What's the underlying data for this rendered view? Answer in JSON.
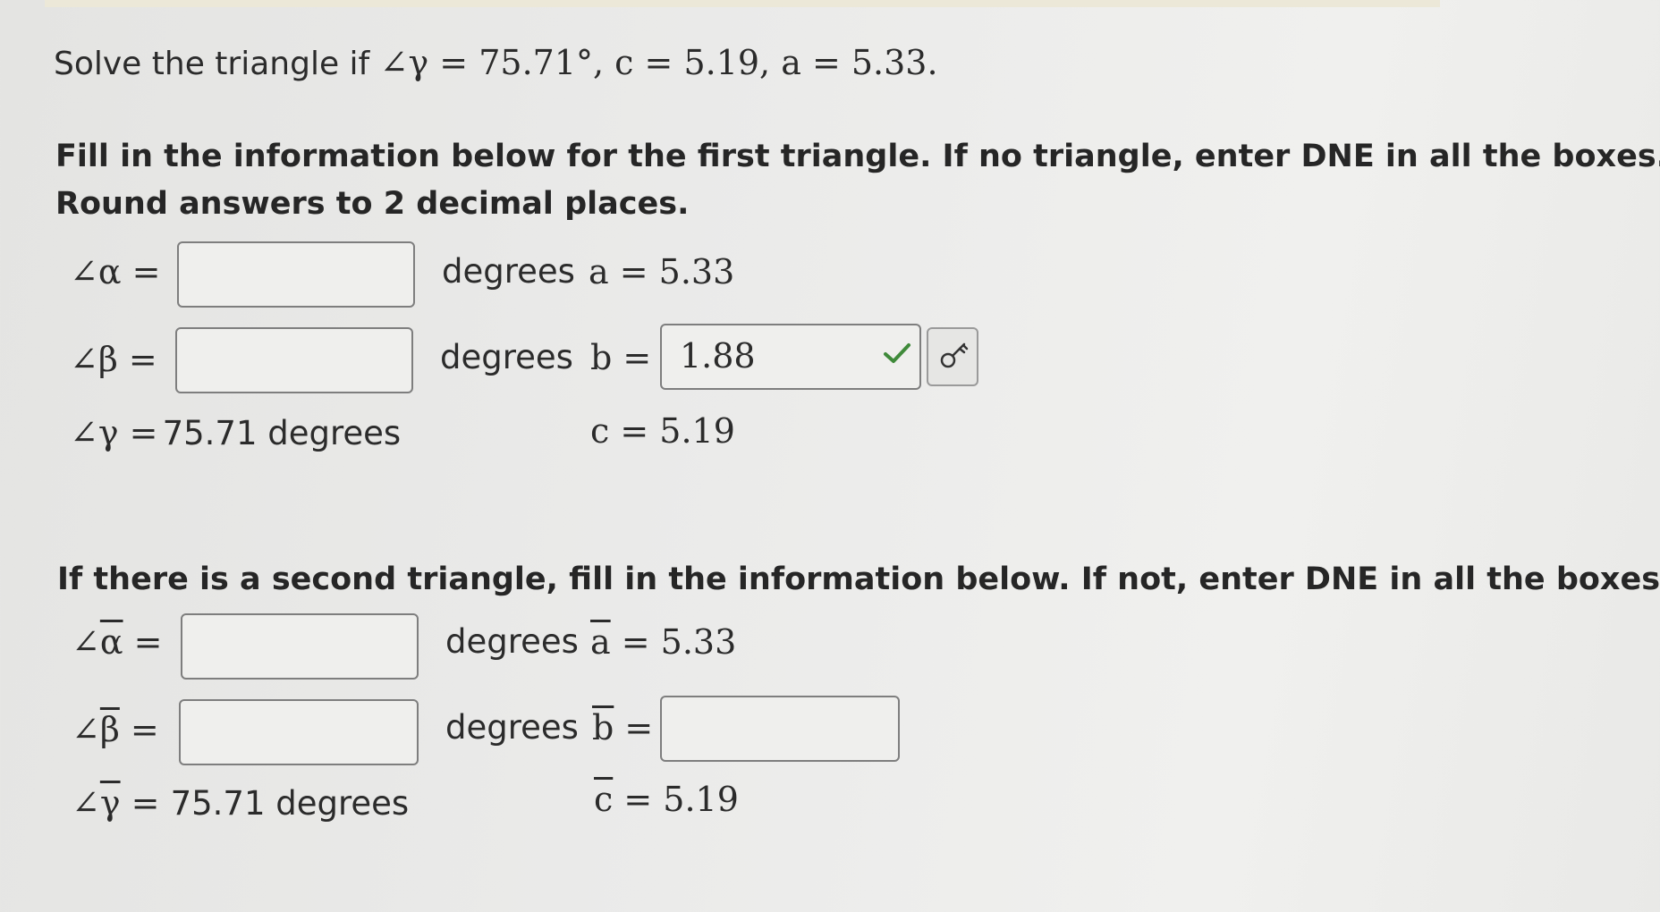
{
  "problem": {
    "prefix": "Solve the triangle if",
    "math": "∠γ = 75.71°, c = 5.19, a = 5.33."
  },
  "first": {
    "instruction_line1": "Fill in the information below for the first triangle. If no triangle, enter DNE in all the boxes.",
    "instruction_line2": "Round answers to 2 decimal places.",
    "alpha_label": "∠α =",
    "beta_label": "∠β =",
    "gamma_label": "∠γ =",
    "gamma_value": "75.71 degrees",
    "alpha_unit": "degrees",
    "beta_unit": "degrees",
    "alpha_input": "",
    "beta_input": "",
    "a_label": "a = 5.33",
    "b_label": "b =",
    "b_input": "1.88",
    "c_label": "c = 5.19"
  },
  "second": {
    "instruction": "If there is a second triangle, fill in the information below. If not, enter DNE in all the boxes.",
    "alpha_label_pre": "∠",
    "alpha_sym": "α",
    "alpha_label_post": " =",
    "beta_label_pre": "∠",
    "beta_sym": "β",
    "beta_label_post": " =",
    "gamma_label_pre": "∠",
    "gamma_sym": "γ",
    "gamma_label_post": " = ",
    "gamma_value": "75.71 degrees",
    "alpha_unit": "degrees",
    "beta_unit": "degrees",
    "alpha_input": "",
    "beta_input": "",
    "a_sym": "a",
    "a_rest": " = 5.33",
    "b_sym": "b",
    "b_rest": " =",
    "b_input": "",
    "c_sym": "c",
    "c_rest": " = 5.19"
  },
  "icons": {
    "correct": "check-icon",
    "key": "key-icon"
  },
  "colors": {
    "correct_check": "#3f8a3a",
    "input_border": "#7e7e7e"
  }
}
